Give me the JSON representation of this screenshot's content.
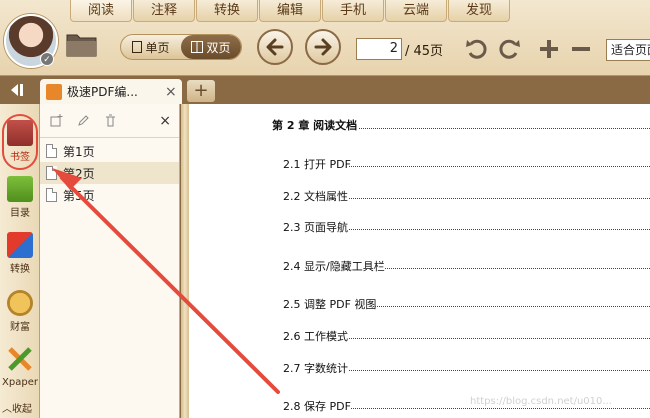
{
  "menu": {
    "tabs": [
      {
        "label": "阅读"
      },
      {
        "label": "注释"
      },
      {
        "label": "转换"
      },
      {
        "label": "编辑"
      },
      {
        "label": "手机"
      },
      {
        "label": "云端"
      },
      {
        "label": "发现"
      }
    ]
  },
  "toolbar": {
    "single_page": "单页",
    "double_page": "双页",
    "current_page": "2",
    "total_pages": "/ 45页",
    "zoom": "适合页面"
  },
  "tabs": {
    "doc_title": "极速PDF编...",
    "close": "×",
    "add": "+"
  },
  "sidebar": {
    "items": [
      {
        "label": "书签"
      },
      {
        "label": "目录"
      },
      {
        "label": "转换"
      },
      {
        "label": "财富"
      },
      {
        "label": "Xpaper"
      }
    ],
    "collapse": "︿收起"
  },
  "bookmarks": {
    "close": "×",
    "items": [
      {
        "label": "第1页"
      },
      {
        "label": "第2页"
      },
      {
        "label": "第5页"
      }
    ]
  },
  "document": {
    "heading": "第 2 章  阅读文档",
    "entries": [
      {
        "label": "2.1 打开 PDF"
      },
      {
        "label": "2.2 文档属性"
      },
      {
        "label": "2.3 页面导航"
      },
      {
        "label": "2.4 显示/隐藏工具栏"
      },
      {
        "label": "2.5 调整 PDF 视图"
      },
      {
        "label": "2.6 工作模式"
      },
      {
        "label": "2.7 字数统计"
      },
      {
        "label": "2.8 保存 PDF"
      }
    ]
  },
  "watermark": "https://blog.csdn.net/u010...",
  "colors": {
    "accent": "#8a6a44",
    "highlight": "#e54b3d"
  }
}
